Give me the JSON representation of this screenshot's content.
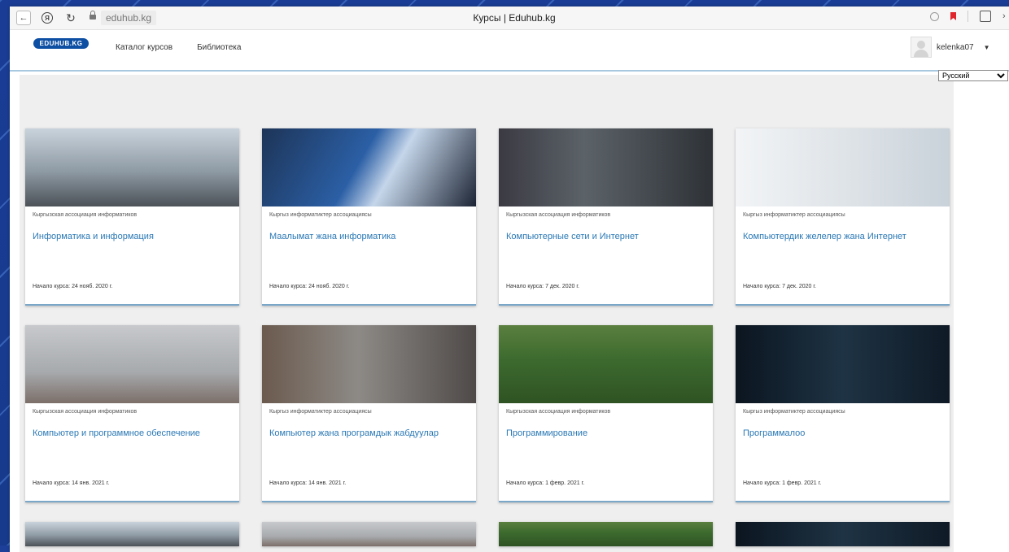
{
  "browser": {
    "url": "eduhub.kg",
    "tab_title": "Курсы | Eduhub.kg"
  },
  "header": {
    "logo": "EDUHUB.KG",
    "nav": [
      "Каталог курсов",
      "Библиотека"
    ],
    "username": "kelenka07"
  },
  "language_selector": {
    "selected": "Русский"
  },
  "courses": [
    {
      "org": "Кыргызская ассоциация информатиков",
      "title": "Информатика и информация",
      "start": "Начало курса: 24 нояб. 2020 г.",
      "scene": "scene-office"
    },
    {
      "org": "Кыргыз информатиктер ассоциациясы",
      "title": "Маалымат жана информатика",
      "start": "Начало курса: 24 нояб. 2020 г.",
      "scene": "scene-monitor"
    },
    {
      "org": "Кыргызская ассоциация информатиков",
      "title": "Компьютерные сети и Интернет",
      "start": "Начало курса: 7 дек. 2020 г.",
      "scene": "scene-dark"
    },
    {
      "org": "Кыргыз информатиктер ассоциациясы",
      "title": "Компьютердик желелер жана Интернет",
      "start": "Начало курса: 7 дек. 2020 г.",
      "scene": "scene-bright"
    },
    {
      "org": "Кыргызская ассоциация информатиков",
      "title": "Компьютер и программное обеспечение",
      "start": "Начало курса: 14 янв. 2021 г.",
      "scene": "scene-laptop"
    },
    {
      "org": "Кыргыз информатиктер ассоциациясы",
      "title": "Компьютер жана програмдык жабдуулар",
      "start": "Начало курса: 14 янв. 2021 г.",
      "scene": "scene-team"
    },
    {
      "org": "Кыргызская ассоциация информатиков",
      "title": "Программирование",
      "start": "Начало курса: 1 февр. 2021 г.",
      "scene": "scene-green"
    },
    {
      "org": "Кыргыз информатиктер ассоциациясы",
      "title": "Программалоо",
      "start": "Начало курса: 1 февр. 2021 г.",
      "scene": "scene-code"
    }
  ],
  "partial_row_scenes": [
    "scene-office",
    "scene-laptop",
    "scene-green",
    "scene-code"
  ]
}
